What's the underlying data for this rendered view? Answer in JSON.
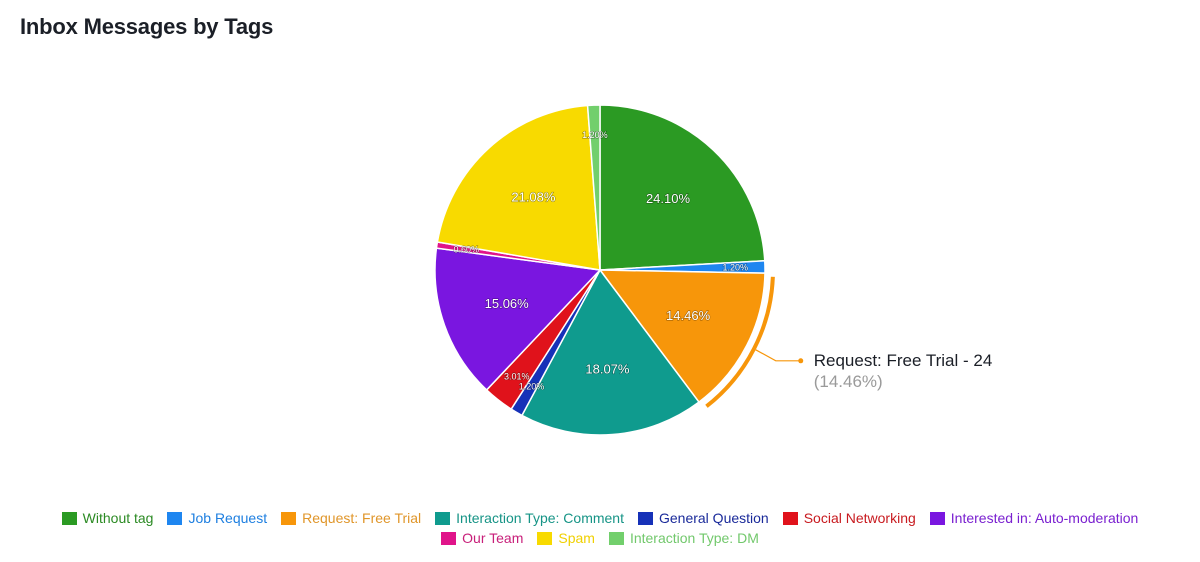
{
  "chart_data": {
    "type": "pie",
    "title": "Inbox Messages by Tags",
    "start": "12 o'clock, clockwise",
    "slices": [
      {
        "label": "Without tag",
        "percent": 24.1,
        "color": "#2b9a23"
      },
      {
        "label": "Job Request",
        "percent": 1.2,
        "color": "#1e86f0"
      },
      {
        "label": "Request: Free Trial",
        "percent": 14.46,
        "count": 24,
        "color": "#f7960a"
      },
      {
        "label": "Interaction Type: Comment",
        "percent": 18.07,
        "color": "#0f9b8e"
      },
      {
        "label": "General Question",
        "percent": 1.2,
        "color": "#1631b8"
      },
      {
        "label": "Social Networking",
        "percent": 3.01,
        "color": "#e0121b"
      },
      {
        "label": "Interested in: Auto-moderation",
        "percent": 15.06,
        "color": "#7a16e0"
      },
      {
        "label": "Our Team",
        "percent": 0.6,
        "color": "#e0148a"
      },
      {
        "label": "Spam",
        "percent": 21.08,
        "color": "#f8da00"
      },
      {
        "label": "Interaction Type: DM",
        "percent": 1.2,
        "color": "#72cf6c"
      }
    ],
    "data_labels": [
      "24.10%",
      "1.20%",
      "14.46%",
      "18.07%",
      "1.20%",
      "3.01%",
      "15.06%",
      "0.60%",
      "21.08%",
      "1.20%"
    ],
    "legend_placement": "bottom-center",
    "legend_rows": [
      [
        0,
        1,
        2,
        3,
        4,
        5,
        6
      ],
      [
        7,
        8,
        9
      ]
    ],
    "legend_text_colors": [
      "#2b8a23",
      "#1e7fe0",
      "#e0962a",
      "#169486",
      "#1a2a9a",
      "#c81a1f",
      "#7a20d0",
      "#c81f7a",
      "#f0d000",
      "#72c86c"
    ],
    "highlighted": {
      "index": 2,
      "tooltip_title": "Request: Free Trial - 24",
      "tooltip_sub": "(14.46%)"
    }
  }
}
